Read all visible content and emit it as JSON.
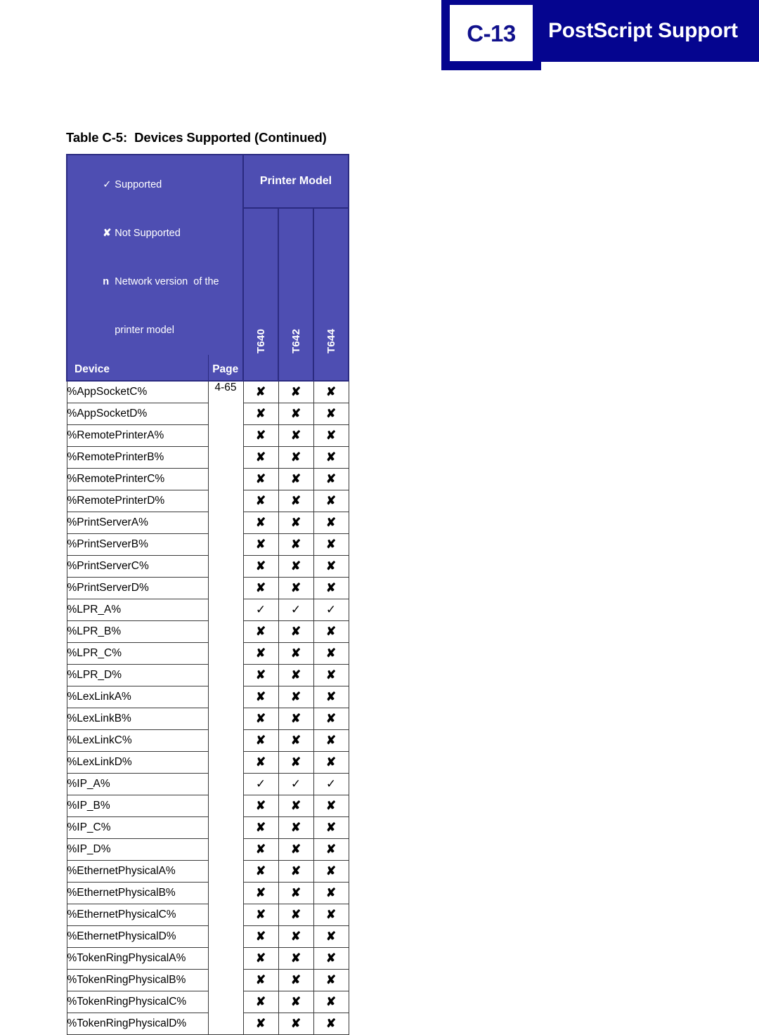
{
  "page_header": {
    "chapter_number": "C-13",
    "title": "PostScript Support",
    "band_color": "#05058f",
    "chapter_text_color": "#10108c"
  },
  "table_caption": "Table C-5:  Devices Supported (Continued)",
  "table": {
    "header_bg_color": "#4e4eb2",
    "header_border_color": "#2b2b80",
    "legend": [
      {
        "symbol": "✓",
        "text": "Supported",
        "symbol_kind": "check"
      },
      {
        "symbol": "✘",
        "text": "Not Supported",
        "symbol_kind": "cross"
      },
      {
        "symbol": "n",
        "text": "Network version  of the",
        "symbol_kind": "letter"
      },
      {
        "symbol": "",
        "text": "printer model",
        "symbol_kind": "continuation"
      }
    ],
    "group_header": "Printer Model",
    "columns": {
      "device": "Device",
      "page": "Page",
      "models": [
        "T640",
        "T642",
        "T644"
      ]
    },
    "page_value": "4-65",
    "rows": [
      {
        "device": "%AppSocketC%",
        "page": "4-65",
        "marks": [
          "x",
          "x",
          "x"
        ]
      },
      {
        "device": "%AppSocketD%",
        "page": "",
        "marks": [
          "x",
          "x",
          "x"
        ]
      },
      {
        "device": "%RemotePrinterA%",
        "page": "",
        "marks": [
          "x",
          "x",
          "x"
        ]
      },
      {
        "device": "%RemotePrinterB%",
        "page": "",
        "marks": [
          "x",
          "x",
          "x"
        ]
      },
      {
        "device": "%RemotePrinterC%",
        "page": "",
        "marks": [
          "x",
          "x",
          "x"
        ]
      },
      {
        "device": "%RemotePrinterD%",
        "page": "",
        "marks": [
          "x",
          "x",
          "x"
        ]
      },
      {
        "device": "%PrintServerA%",
        "page": "",
        "marks": [
          "x",
          "x",
          "x"
        ]
      },
      {
        "device": "%PrintServerB%",
        "page": "",
        "marks": [
          "x",
          "x",
          "x"
        ]
      },
      {
        "device": "%PrintServerC%",
        "page": "",
        "marks": [
          "x",
          "x",
          "x"
        ]
      },
      {
        "device": "%PrintServerD%",
        "page": "",
        "marks": [
          "x",
          "x",
          "x"
        ]
      },
      {
        "device": "%LPR_A%",
        "page": "",
        "marks": [
          "c",
          "c",
          "c"
        ]
      },
      {
        "device": "%LPR_B%",
        "page": "",
        "marks": [
          "x",
          "x",
          "x"
        ]
      },
      {
        "device": "%LPR_C%",
        "page": "",
        "marks": [
          "x",
          "x",
          "x"
        ]
      },
      {
        "device": "%LPR_D%",
        "page": "",
        "marks": [
          "x",
          "x",
          "x"
        ]
      },
      {
        "device": "%LexLinkA%",
        "page": "",
        "marks": [
          "x",
          "x",
          "x"
        ]
      },
      {
        "device": "%LexLinkB%",
        "page": "",
        "marks": [
          "x",
          "x",
          "x"
        ]
      },
      {
        "device": "%LexLinkC%",
        "page": "",
        "marks": [
          "x",
          "x",
          "x"
        ]
      },
      {
        "device": "%LexLinkD%",
        "page": "",
        "marks": [
          "x",
          "x",
          "x"
        ]
      },
      {
        "device": "%IP_A%",
        "page": "",
        "marks": [
          "c",
          "c",
          "c"
        ]
      },
      {
        "device": "%IP_B%",
        "page": "",
        "marks": [
          "x",
          "x",
          "x"
        ]
      },
      {
        "device": "%IP_C%",
        "page": "",
        "marks": [
          "x",
          "x",
          "x"
        ]
      },
      {
        "device": "%IP_D%",
        "page": "",
        "marks": [
          "x",
          "x",
          "x"
        ]
      },
      {
        "device": "%EthernetPhysicalA%",
        "page": "",
        "marks": [
          "x",
          "x",
          "x"
        ]
      },
      {
        "device": "%EthernetPhysicalB%",
        "page": "",
        "marks": [
          "x",
          "x",
          "x"
        ]
      },
      {
        "device": "%EthernetPhysicalC%",
        "page": "",
        "marks": [
          "x",
          "x",
          "x"
        ]
      },
      {
        "device": "%EthernetPhysicalD%",
        "page": "",
        "marks": [
          "x",
          "x",
          "x"
        ]
      },
      {
        "device": "%TokenRingPhysicalA%",
        "page": "",
        "marks": [
          "x",
          "x",
          "x"
        ]
      },
      {
        "device": "%TokenRingPhysicalB%",
        "page": "",
        "marks": [
          "x",
          "x",
          "x"
        ]
      },
      {
        "device": "%TokenRingPhysicalC%",
        "page": "",
        "marks": [
          "x",
          "x",
          "x"
        ]
      },
      {
        "device": "%TokenRingPhysicalD%",
        "page": "",
        "marks": [
          "x",
          "x",
          "x"
        ]
      }
    ],
    "mark_glyphs": {
      "x": "✘",
      "c": "✓"
    }
  }
}
